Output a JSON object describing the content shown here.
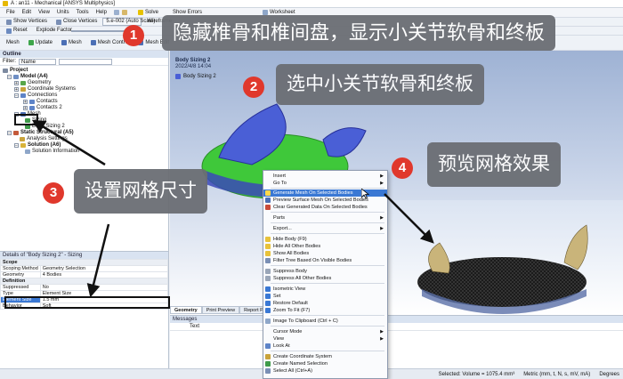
{
  "window": {
    "title": "A : an11 - Mechanical [ANSYS Multiphysics]"
  },
  "menu": [
    "File",
    "Edit",
    "View",
    "Units",
    "Tools",
    "Help"
  ],
  "toolbar": {
    "solve": "Solve",
    "show_errors": "Show Errors",
    "worksheet": "Worksheet",
    "show_vertices": "Show Vertices",
    "close_vertices": "Close Vertices",
    "auto_scale": "5.e-002 (Auto Scale)",
    "wireframe": "Wireframe",
    "reset": "Reset",
    "explode_factor": "Explode Factor",
    "mesh": "Mesh",
    "update": "Update",
    "mesh_btn": "Mesh",
    "mesh_control": "Mesh Control",
    "mesh_edit": "Mesh Edit"
  },
  "outline": {
    "header": "Outline",
    "filter_label": "Filter:",
    "filter_value": "Name",
    "tree": [
      {
        "label": "Project"
      },
      {
        "label": "Model (A4)"
      },
      {
        "label": "Geometry"
      },
      {
        "label": "Coordinate Systems"
      },
      {
        "label": "Connections"
      },
      {
        "label": "Contacts"
      },
      {
        "label": "Contacts 2"
      },
      {
        "label": "Mesh"
      },
      {
        "label": "Sizing"
      },
      {
        "label": "Body Sizing 2"
      },
      {
        "label": "Static Structural (A5)"
      },
      {
        "label": "Analysis Settings"
      },
      {
        "label": "Solution (A6)"
      },
      {
        "label": "Solution Information"
      }
    ]
  },
  "details": {
    "header": "Details of \"Body Sizing 2\" - Sizing",
    "rows": [
      {
        "key": "Scope",
        "value": "",
        "section": true
      },
      {
        "key": "Scoping Method",
        "value": "Geometry Selection",
        "section": false
      },
      {
        "key": "Geometry",
        "value": "4 Bodies",
        "section": false
      },
      {
        "key": "Definition",
        "value": "",
        "section": true
      },
      {
        "key": "Suppressed",
        "value": "No",
        "section": false
      },
      {
        "key": "Type",
        "value": "Element Size",
        "section": false
      },
      {
        "key": "Element Size",
        "value": "1.5 mm",
        "section": false
      },
      {
        "key": "Behavior",
        "value": "Soft",
        "section": false
      }
    ]
  },
  "graphics": {
    "label_title": "Body Sizing 2",
    "label_date": "2022/4/8 14:04",
    "legend_item": "Body Sizing 2"
  },
  "graphics_tabs": [
    "Geometry",
    "Print Preview",
    "Report Preview"
  ],
  "messages": {
    "header": "Messages",
    "col_text": "Text"
  },
  "status": {
    "selection": "Selected: Volume = 1075.4 mm³",
    "units": "Metric (mm, t, N, s, mV, mA)",
    "angle": "Degrees"
  },
  "context_menu": {
    "items": [
      {
        "label": "Insert",
        "submenu": true,
        "highlight": false,
        "icon": ""
      },
      {
        "label": "Go To",
        "submenu": true,
        "highlight": false,
        "icon": ""
      },
      {
        "label": "Generate Mesh On Selected Bodies",
        "submenu": false,
        "highlight": true,
        "icon": "mesh-icon"
      },
      {
        "label": "Preview Surface Mesh On Selected Bodies",
        "submenu": false,
        "highlight": false,
        "icon": "preview-icon"
      },
      {
        "label": "Clear Generated Data On Selected Bodies",
        "submenu": false,
        "highlight": false,
        "icon": "clear-icon"
      },
      {
        "label": "Parts",
        "submenu": true,
        "highlight": false,
        "icon": ""
      },
      {
        "label": "Export...",
        "submenu": true,
        "highlight": false,
        "icon": ""
      },
      {
        "label": "Hide Body (F9)",
        "submenu": false,
        "highlight": false,
        "icon": "bulb-icon"
      },
      {
        "label": "Hide All Other Bodies",
        "submenu": false,
        "highlight": false,
        "icon": "bulb-icon"
      },
      {
        "label": "Show All Bodies",
        "submenu": false,
        "highlight": false,
        "icon": "bulb-icon"
      },
      {
        "label": "Filter Tree Based On Visible Bodies",
        "submenu": false,
        "highlight": false,
        "icon": "filter-icon"
      },
      {
        "label": "Suppress Body",
        "submenu": false,
        "highlight": false,
        "icon": "suppress-icon"
      },
      {
        "label": "Suppress All Other Bodies",
        "submenu": false,
        "highlight": false,
        "icon": "suppress-icon"
      },
      {
        "label": "Isometric View",
        "submenu": false,
        "highlight": false,
        "icon": "iso-icon"
      },
      {
        "label": "Set",
        "submenu": false,
        "highlight": false,
        "icon": "set-icon"
      },
      {
        "label": "Restore Default",
        "submenu": false,
        "highlight": false,
        "icon": "restore-icon"
      },
      {
        "label": "Zoom To Fit (F7)",
        "submenu": false,
        "highlight": false,
        "icon": "zoom-icon"
      },
      {
        "label": "Image To Clipboard (Ctrl + C)",
        "submenu": false,
        "highlight": false,
        "icon": "clipboard-icon"
      },
      {
        "label": "Cursor Mode",
        "submenu": true,
        "highlight": false,
        "icon": ""
      },
      {
        "label": "View",
        "submenu": true,
        "highlight": false,
        "icon": ""
      },
      {
        "label": "Look At",
        "submenu": false,
        "highlight": false,
        "icon": "eye-icon"
      },
      {
        "label": "Create Coordinate System",
        "submenu": false,
        "highlight": false,
        "icon": "coord-icon"
      },
      {
        "label": "Create Named Selection",
        "submenu": false,
        "highlight": false,
        "icon": "named-icon"
      },
      {
        "label": "Select All (Ctrl+A)",
        "submenu": false,
        "highlight": false,
        "icon": "select-icon"
      }
    ]
  },
  "annotations": {
    "step1": {
      "num": "1",
      "text": "隐藏椎骨和椎间盘，显示小关节软骨和终板"
    },
    "step2": {
      "num": "2",
      "text": "选中小关节软骨和终板"
    },
    "step3": {
      "num": "3",
      "text": "设置网格尺寸"
    },
    "step4": {
      "num": "4",
      "text": "预览网格效果"
    }
  },
  "colors": {
    "callout_bg": "#6b6e74",
    "badge": "#e0382c",
    "menu_highlight": "#3a78d4",
    "mesh_green": "#3fc83a",
    "mesh_blue": "#4a5fd6",
    "mesh_tan": "#c9b47a"
  }
}
